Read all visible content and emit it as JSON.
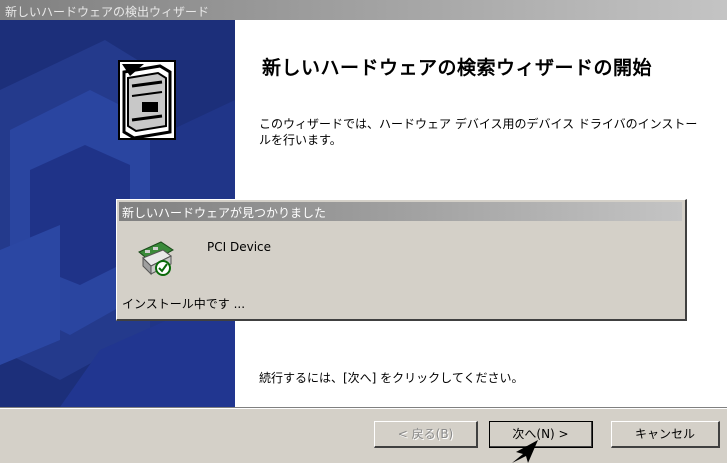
{
  "wizard": {
    "title": "新しいハードウェアの検出ウィザード",
    "heading": "新しいハードウェアの検索ウィザードの開始",
    "description": "このウィザードでは、ハードウェア デバイス用のデバイス ドライバのインストールを行います。",
    "continue_text": "続行するには、[次へ] をクリックしてください。",
    "buttons": {
      "back": "< 戻る(B)",
      "next": "次へ(N) >",
      "cancel": "キャンセル"
    }
  },
  "popup": {
    "title": "新しいハードウェアが見つかりました",
    "device_name": "PCI Device",
    "status": "インストール中です ..."
  },
  "icons": {
    "wizard": "hardware-box-icon",
    "device": "pci-device-icon",
    "cursor": "mouse-pointer-icon"
  }
}
